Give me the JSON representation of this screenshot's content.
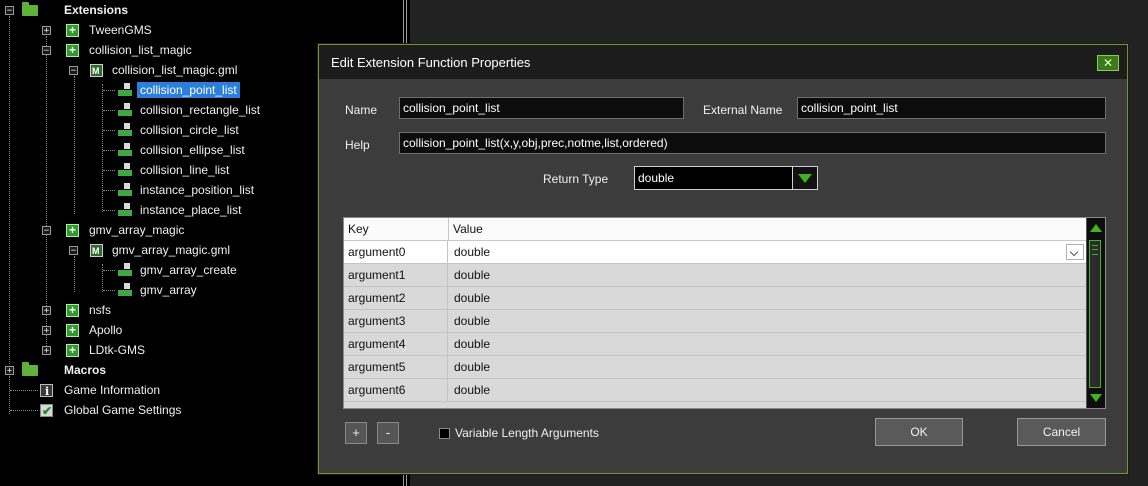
{
  "tree": {
    "extensions": "Extensions",
    "tweengms": "TweenGMS",
    "collision_list_magic": "collision_list_magic",
    "collision_list_magic_gml": "collision_list_magic.gml",
    "functions_1": [
      "collision_point_list",
      "collision_rectangle_list",
      "collision_circle_list",
      "collision_ellipse_list",
      "collision_line_list",
      "instance_position_list",
      "instance_place_list"
    ],
    "gmv_array_magic": "gmv_array_magic",
    "gmv_array_magic_gml": "gmv_array_magic.gml",
    "functions_2": [
      "gmv_array_create",
      "gmv_array"
    ],
    "nsfs": "nsfs",
    "apollo": "Apollo",
    "ldtk": "LDtk-GMS",
    "macros": "Macros",
    "game_info": "Game Information",
    "global_settings": "Global Game Settings"
  },
  "dialog": {
    "title": "Edit Extension Function Properties",
    "close_glyph": "✕",
    "name_label": "Name",
    "name_value": "collision_point_list",
    "external_name_label": "External Name",
    "external_name_value": "collision_point_list",
    "help_label": "Help",
    "help_value": "collision_point_list(x,y,obj,prec,notme,list,ordered)",
    "return_type_label": "Return Type",
    "return_type_value": "double",
    "grid": {
      "col_key": "Key",
      "col_value": "Value",
      "rows": [
        {
          "key": "argument0",
          "value": "double"
        },
        {
          "key": "argument1",
          "value": "double"
        },
        {
          "key": "argument2",
          "value": "double"
        },
        {
          "key": "argument3",
          "value": "double"
        },
        {
          "key": "argument4",
          "value": "double"
        },
        {
          "key": "argument5",
          "value": "double"
        },
        {
          "key": "argument6",
          "value": "double"
        }
      ]
    },
    "add_label": "+",
    "remove_label": "-",
    "variable_args_label": "Variable Length Arguments",
    "ok_label": "OK",
    "cancel_label": "Cancel"
  },
  "colors": {
    "accent_green": "#3fb41e",
    "selection_blue": "#2a7fdc",
    "dialog_bg": "#3c3c3c"
  }
}
